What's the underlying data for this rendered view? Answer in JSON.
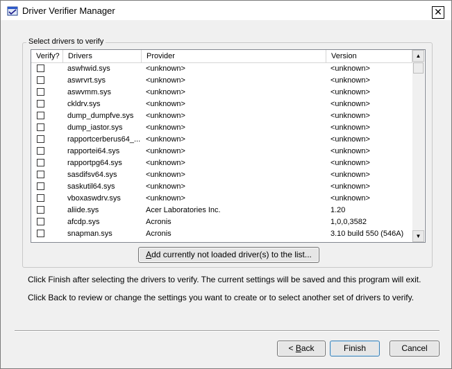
{
  "window": {
    "title": "Driver Verifier Manager",
    "close_glyph": "✕"
  },
  "group": {
    "legend": "Select drivers to verify"
  },
  "list": {
    "columns": [
      {
        "label": "Verify?"
      },
      {
        "label": "Drivers"
      },
      {
        "label": "Provider"
      },
      {
        "label": "Version"
      }
    ],
    "rows": [
      {
        "checked": false,
        "driver": "aswhwid.sys",
        "provider": "<unknown>",
        "version": "<unknown>"
      },
      {
        "checked": false,
        "driver": "aswrvrt.sys",
        "provider": "<unknown>",
        "version": "<unknown>"
      },
      {
        "checked": false,
        "driver": "aswvmm.sys",
        "provider": "<unknown>",
        "version": "<unknown>"
      },
      {
        "checked": false,
        "driver": "ckldrv.sys",
        "provider": "<unknown>",
        "version": "<unknown>"
      },
      {
        "checked": false,
        "driver": "dump_dumpfve.sys",
        "provider": "<unknown>",
        "version": "<unknown>"
      },
      {
        "checked": false,
        "driver": "dump_iastor.sys",
        "provider": "<unknown>",
        "version": "<unknown>"
      },
      {
        "checked": false,
        "driver": "rapportcerberus64_...",
        "provider": "<unknown>",
        "version": "<unknown>"
      },
      {
        "checked": false,
        "driver": "rapportei64.sys",
        "provider": "<unknown>",
        "version": "<unknown>"
      },
      {
        "checked": false,
        "driver": "rapportpg64.sys",
        "provider": "<unknown>",
        "version": "<unknown>"
      },
      {
        "checked": false,
        "driver": "sasdifsv64.sys",
        "provider": "<unknown>",
        "version": "<unknown>"
      },
      {
        "checked": false,
        "driver": "saskutil64.sys",
        "provider": "<unknown>",
        "version": "<unknown>"
      },
      {
        "checked": false,
        "driver": "vboxaswdrv.sys",
        "provider": "<unknown>",
        "version": "<unknown>"
      },
      {
        "checked": false,
        "driver": "aliide.sys",
        "provider": "Acer Laboratories Inc.",
        "version": "1.20"
      },
      {
        "checked": false,
        "driver": "afcdp.sys",
        "provider": "Acronis",
        "version": "1,0,0,3582"
      },
      {
        "checked": false,
        "driver": "snapman.sys",
        "provider": "Acronis",
        "version": "3.10 build 550 (546A)"
      }
    ],
    "scroll_up_glyph": "▲",
    "scroll_down_glyph": "▼"
  },
  "add_button": {
    "accel": "A",
    "rest": "dd currently not loaded driver(s) to the list..."
  },
  "info": {
    "line1": "Click Finish after selecting the drivers to verify. The current settings will be saved and this program will exit.",
    "line2": "Click Back to review or change the settings you want to create or to select another set of drivers to verify."
  },
  "buttons": {
    "back_prefix": "< ",
    "back_accel": "B",
    "back_rest": "ack",
    "finish": "Finish",
    "cancel": "Cancel"
  },
  "icons": {
    "title": "verifier-app-icon",
    "close": "close-icon"
  }
}
